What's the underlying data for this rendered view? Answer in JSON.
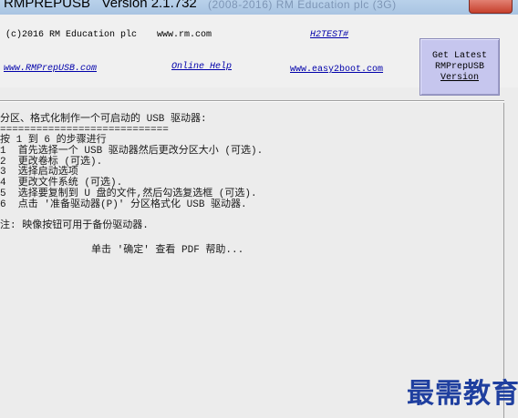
{
  "window": {
    "title": "RMPREPUSB   Version 2.1.732",
    "title_faded": "(2008-2016) RM Education plc (3G)"
  },
  "header": {
    "copyright": "(c)2016 RM Education plc",
    "site": "www.rm.com",
    "hotkey_link": "H2TEST#",
    "site_link": "www.RMPrepUSB.com",
    "online_help": "Online Help",
    "easy2boot": "www.easy2boot.com",
    "get_latest": {
      "line1": "Get Latest",
      "line2": "RMPrepUSB",
      "line3": "Version"
    }
  },
  "instructions": {
    "heading": "分区、格式化制作一个可启动的 USB 驱动器:",
    "rule": "============================",
    "step_intro": "按 1 到 6 的步骤进行",
    "steps": [
      "1  首先选择一个 USB 驱动器然后更改分区大小 (可选).",
      "2  更改卷标 (可选).",
      "3  选择启动选项",
      "4  更改文件系统 (可选).",
      "5  选择要复制到 U 盘的文件,然后勾选复选框 (可选).",
      "6  点击 '准备驱动器(P)' 分区格式化 USB 驱动器."
    ],
    "note": "注: 映像按钮可用于备份驱动器.",
    "pdf_help": "单击 '确定' 查看 PDF 帮助..."
  },
  "watermark": "最需教育",
  "colors": {
    "link": "#0000aa",
    "button_bg": "#c6c6ee",
    "watermark": "#1f3f9f"
  }
}
